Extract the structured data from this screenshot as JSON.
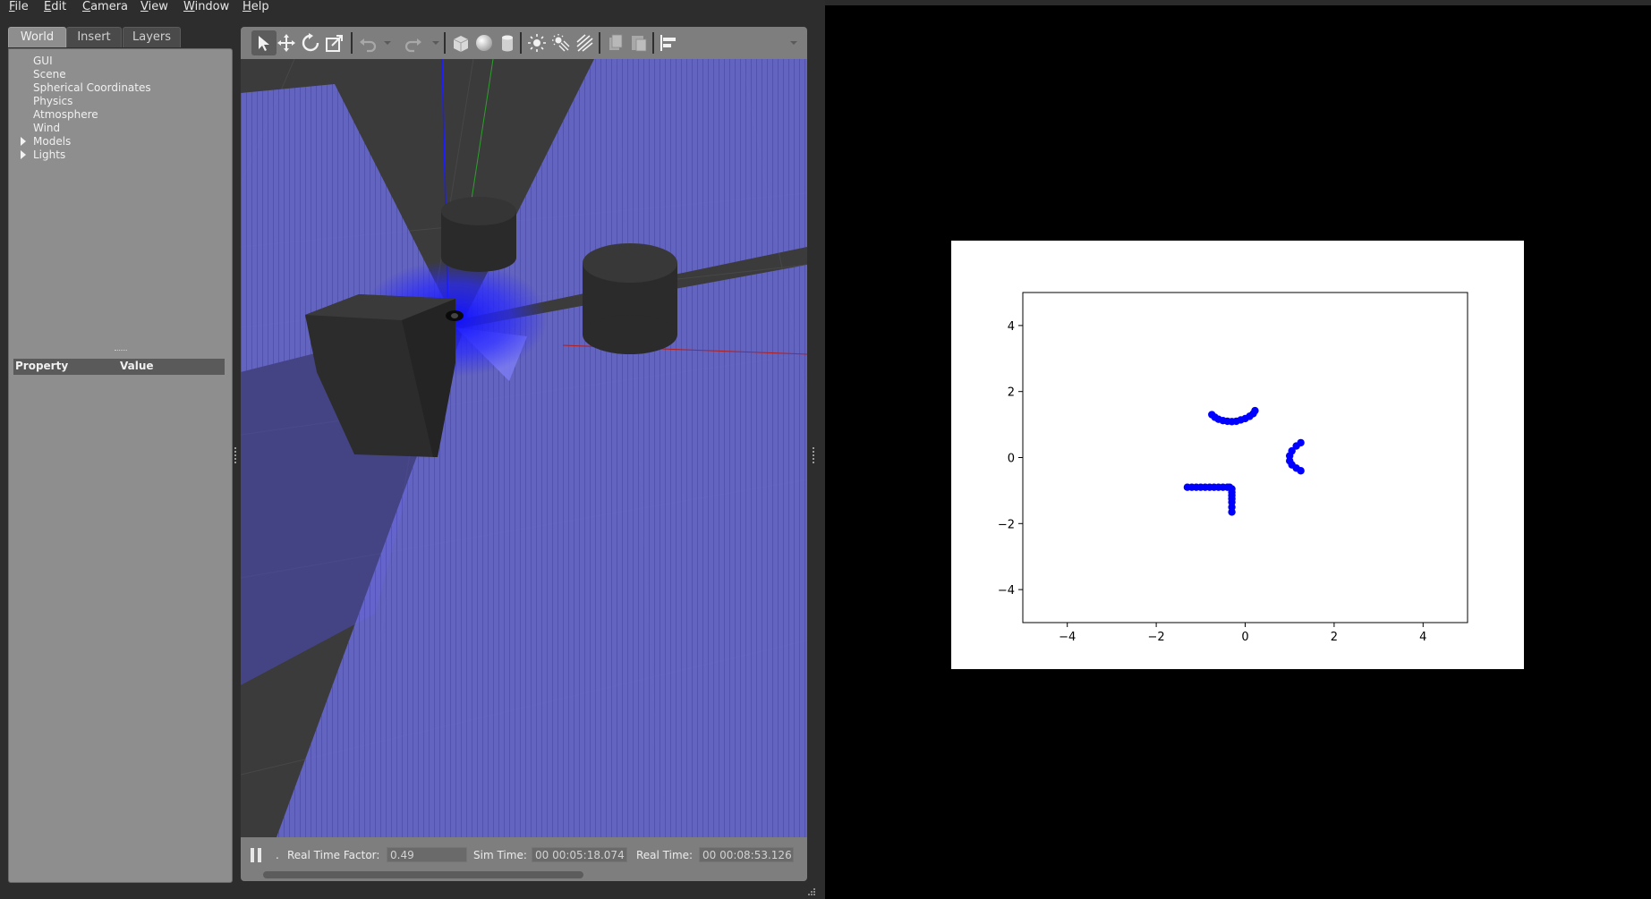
{
  "app": {
    "menu": [
      "File",
      "Edit",
      "Camera",
      "View",
      "Window",
      "Help"
    ]
  },
  "left_panel": {
    "tabs": [
      "World",
      "Insert",
      "Layers"
    ],
    "active_tab": "World",
    "tree": [
      {
        "label": "GUI",
        "expandable": false
      },
      {
        "label": "Scene",
        "expandable": false
      },
      {
        "label": "Spherical Coordinates",
        "expandable": false
      },
      {
        "label": "Physics",
        "expandable": false
      },
      {
        "label": "Atmosphere",
        "expandable": false
      },
      {
        "label": "Wind",
        "expandable": false
      },
      {
        "label": "Models",
        "expandable": true
      },
      {
        "label": "Lights",
        "expandable": true
      }
    ],
    "property_header": {
      "property": "Property",
      "value": "Value"
    }
  },
  "toolbar": {
    "tools": [
      "select-mode",
      "translate-mode",
      "rotate-mode",
      "scale-mode",
      "undo",
      "redo",
      "box-shape",
      "sphere-shape",
      "cylinder-shape",
      "point-light",
      "spot-light",
      "directional-light",
      "copy",
      "paste",
      "align"
    ],
    "active_tool": "select-mode"
  },
  "status_bar": {
    "paused": false,
    "dot_label": ".",
    "real_time_factor_label": "Real Time Factor:",
    "real_time_factor": "0.49",
    "sim_time_label": "Sim Time:",
    "sim_time": "00 00:05:18.074",
    "real_time_label": "Real Time:",
    "real_time": "00 00:08:53.126"
  },
  "colors": {
    "laser": "#3a3aff",
    "background_dark": "#2d2d2d",
    "panel": "#8e8e8e",
    "plot_points": "#0000ff"
  },
  "chart_data": {
    "type": "scatter",
    "title": "",
    "xlabel": "",
    "ylabel": "",
    "xlim": [
      -5,
      5
    ],
    "ylim": [
      -5,
      5
    ],
    "xticks": [
      -4,
      -2,
      0,
      2,
      4
    ],
    "yticks": [
      -4,
      -2,
      0,
      2,
      4
    ],
    "grid": false,
    "series": [
      {
        "color": "#0000ff",
        "x": [
          -0.75,
          -0.68,
          -0.6,
          -0.5,
          -0.4,
          -0.3,
          -0.2,
          -0.1,
          0.0,
          0.1,
          0.18,
          0.22,
          -1.3,
          -1.2,
          -1.1,
          -1.0,
          -0.9,
          -0.8,
          -0.7,
          -0.6,
          -0.5,
          -0.4,
          -0.35,
          -0.3,
          -0.3,
          -0.3,
          -0.3,
          -0.3,
          -0.3,
          -0.3,
          1.25,
          1.15,
          1.05,
          1.0,
          1.0,
          1.05,
          1.15,
          1.25
        ],
        "y": [
          1.3,
          1.22,
          1.16,
          1.12,
          1.1,
          1.09,
          1.1,
          1.14,
          1.18,
          1.25,
          1.33,
          1.42,
          -0.9,
          -0.9,
          -0.9,
          -0.9,
          -0.9,
          -0.9,
          -0.9,
          -0.9,
          -0.9,
          -0.9,
          -0.9,
          -0.95,
          -1.05,
          -1.15,
          -1.25,
          -1.35,
          -1.5,
          -1.65,
          0.45,
          0.35,
          0.2,
          0.05,
          -0.1,
          -0.22,
          -0.32,
          -0.4
        ]
      }
    ]
  }
}
